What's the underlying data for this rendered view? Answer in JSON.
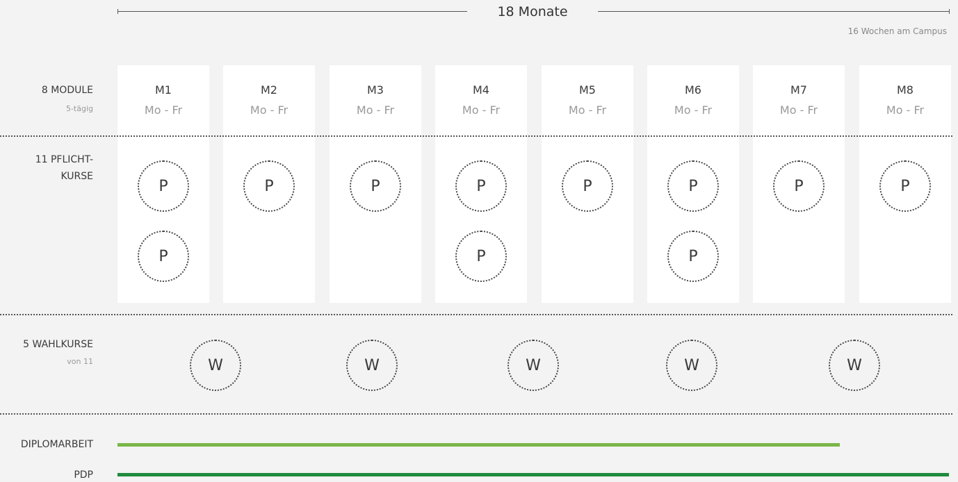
{
  "timeline": {
    "label": "18 Monate",
    "note": "16 Wochen am Campus"
  },
  "rows": {
    "modules": {
      "label": "8 MODULE",
      "sub": "5-tägig"
    },
    "required": {
      "label_line1": "11 PFLICHT-",
      "label_line2": "KURSE"
    },
    "electives": {
      "label": "5 WAHLKURSE",
      "sub": "von 11"
    },
    "thesis": {
      "label": "DIPLOMARBEIT"
    },
    "pdp": {
      "label": "PDP"
    }
  },
  "modules": [
    {
      "name": "M1",
      "days": "Mo - Fr",
      "required_count": 2
    },
    {
      "name": "M2",
      "days": "Mo - Fr",
      "required_count": 1
    },
    {
      "name": "M3",
      "days": "Mo - Fr",
      "required_count": 1
    },
    {
      "name": "M4",
      "days": "Mo - Fr",
      "required_count": 2
    },
    {
      "name": "M5",
      "days": "Mo - Fr",
      "required_count": 1
    },
    {
      "name": "M6",
      "days": "Mo - Fr",
      "required_count": 2
    },
    {
      "name": "M7",
      "days": "Mo - Fr",
      "required_count": 1
    },
    {
      "name": "M8",
      "days": "Mo - Fr",
      "required_count": 1
    }
  ],
  "required_symbol": "P",
  "elective_symbol": "W",
  "elective_count": 5,
  "bars": {
    "thesis": {
      "color": "#7ab648",
      "fraction": 0.869
    },
    "pdp": {
      "color": "#1f8a3c",
      "fraction": 1.0
    }
  }
}
